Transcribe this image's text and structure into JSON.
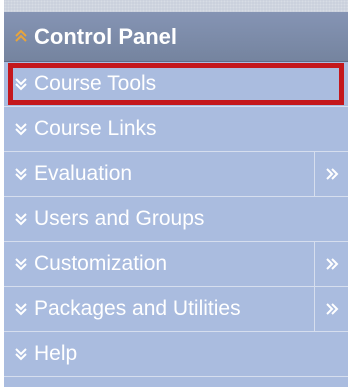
{
  "control_panel": {
    "title": "Control Panel",
    "icon": "chevron-double-up-icon",
    "icon_color": "#e8a43a"
  },
  "menu": {
    "items": [
      {
        "label": "Course Tools",
        "icon": "chevron-double-down-icon",
        "has_submenu": false,
        "highlighted": true
      },
      {
        "label": "Course Links",
        "icon": "chevron-double-down-icon",
        "has_submenu": false,
        "highlighted": false
      },
      {
        "label": "Evaluation",
        "icon": "chevron-double-down-icon",
        "has_submenu": true,
        "highlighted": false
      },
      {
        "label": "Users and Groups",
        "icon": "chevron-double-down-icon",
        "has_submenu": false,
        "highlighted": false
      },
      {
        "label": "Customization",
        "icon": "chevron-double-down-icon",
        "has_submenu": true,
        "highlighted": false
      },
      {
        "label": "Packages and Utilities",
        "icon": "chevron-double-down-icon",
        "has_submenu": true,
        "highlighted": false
      },
      {
        "label": "Help",
        "icon": "chevron-double-down-icon",
        "has_submenu": false,
        "highlighted": false
      }
    ]
  },
  "colors": {
    "panel_background": "#aabcdf",
    "header_background": "#7d8ca9",
    "highlight_border": "#c4171c",
    "text": "#ffffff"
  }
}
